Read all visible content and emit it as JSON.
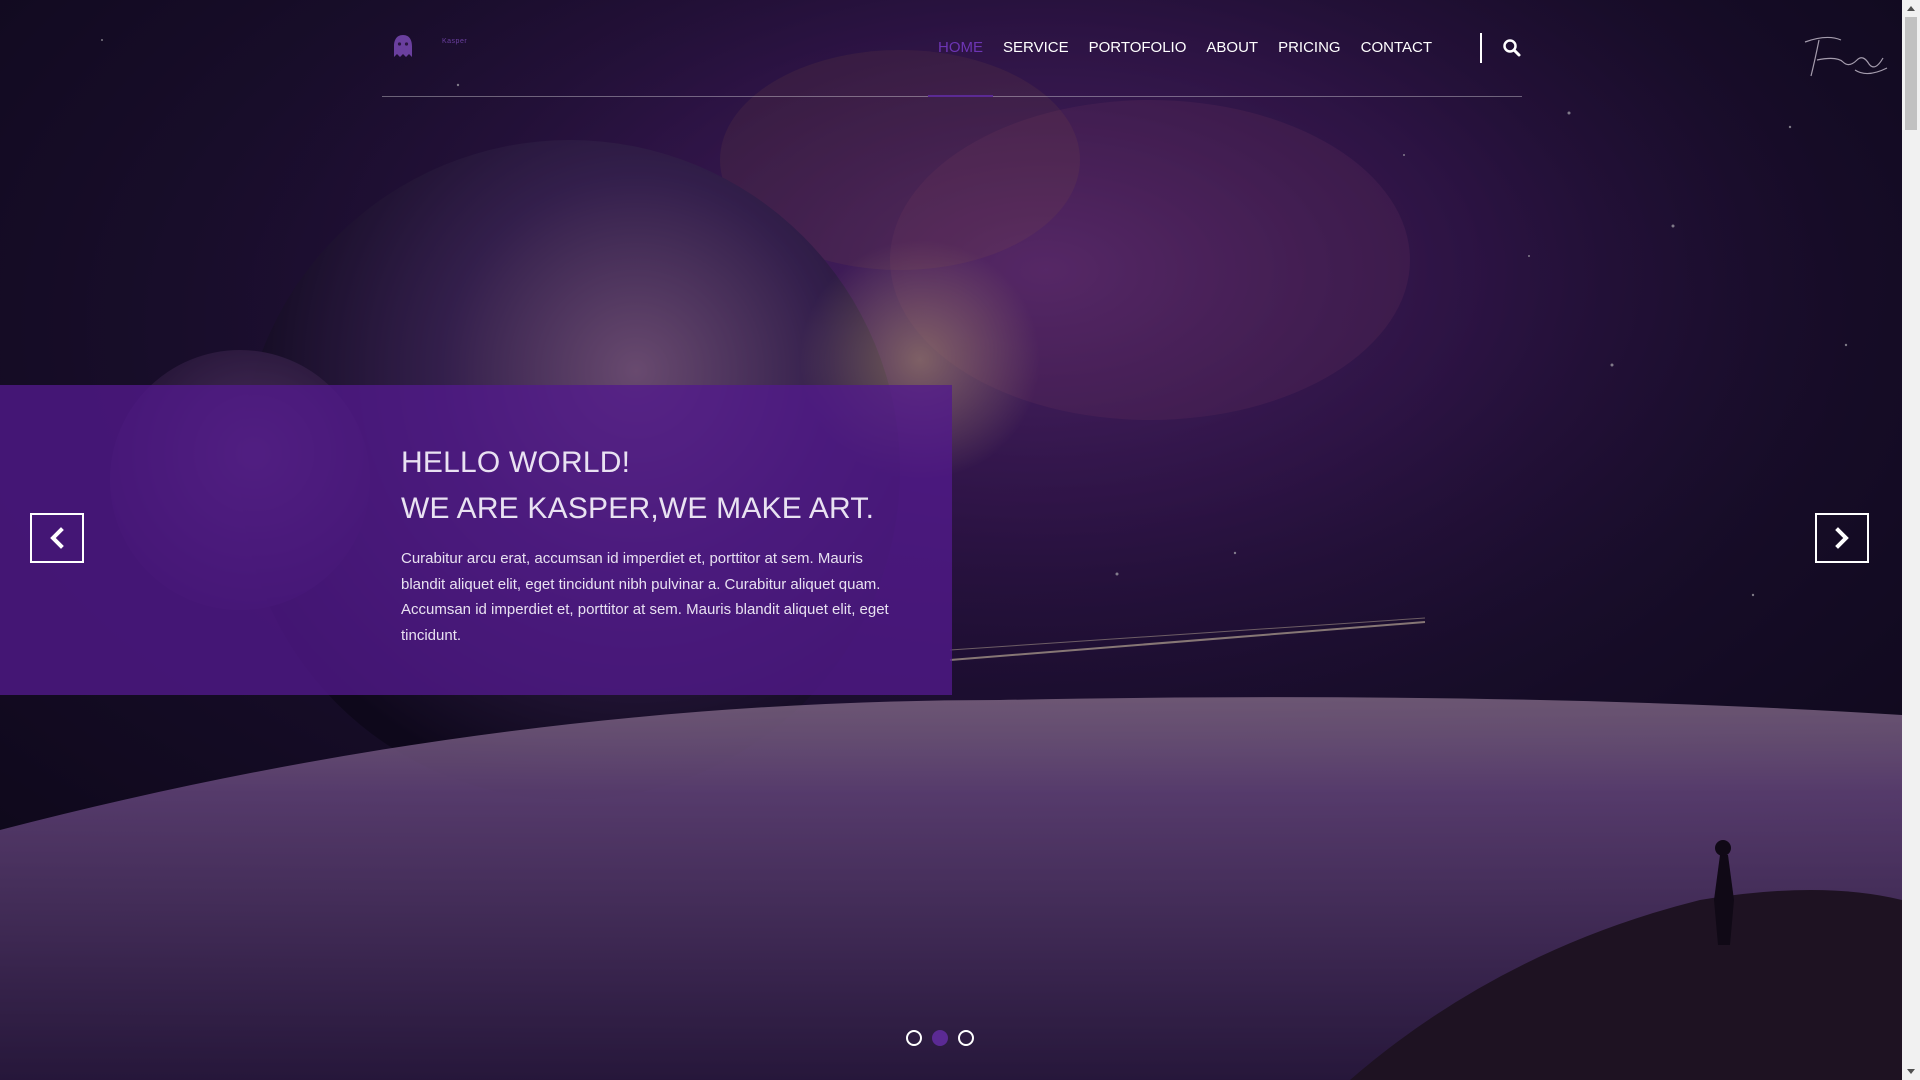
{
  "header": {
    "logo_icon": "ghost-icon",
    "logo_text": "Kasper",
    "nav": [
      {
        "label": "HOME",
        "active": true
      },
      {
        "label": "SERVICE",
        "active": false
      },
      {
        "label": "PORTOFOLIO",
        "active": false
      },
      {
        "label": "ABOUT",
        "active": false
      },
      {
        "label": "PRICING",
        "active": false
      },
      {
        "label": "CONTACT",
        "active": false
      }
    ],
    "search_icon": "search-icon"
  },
  "slider": {
    "title_line1": "HELLO WORLD!",
    "title_line2": "WE ARE KASPER,WE MAKE ART.",
    "text": "Curabitur arcu erat, accumsan id imperdiet et, porttitor at sem. Mauris blandit aliquet elit, eget tincidunt nibh pulvinar a. Curabitur aliquet quam. Accumsan id imperdiet et, porttitor at sem. Mauris blandit aliquet elit, eget tincidunt.",
    "prev_icon": "chevron-left-icon",
    "next_icon": "chevron-right-icon",
    "dots_count": 3,
    "active_dot": 2
  },
  "colors": {
    "accent": "#5b2a94",
    "panel": "#521a8c",
    "background": "#120c1e"
  }
}
